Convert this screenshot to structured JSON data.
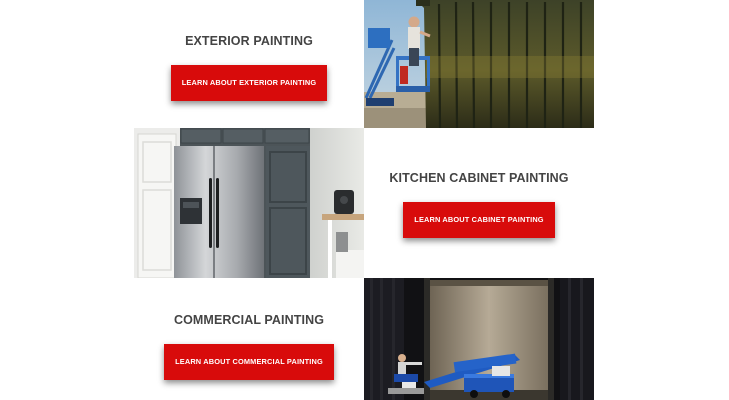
{
  "sections": {
    "exterior": {
      "heading": "EXTERIOR PAINTING",
      "button_label": "LEARN ABOUT EXTERIOR PAINTING"
    },
    "cabinet": {
      "heading": "KITCHEN CABINET PAINTING",
      "button_label": "LEARN ABOUT CABINET PAINTING"
    },
    "commercial": {
      "heading": "COMMERCIAL PAINTING",
      "button_label": "LEARN ABOUT COMMERCIAL PAINTING"
    }
  },
  "colors": {
    "button_red": "#d80b0b",
    "heading_gray": "#444444",
    "background": "#ffffff"
  }
}
